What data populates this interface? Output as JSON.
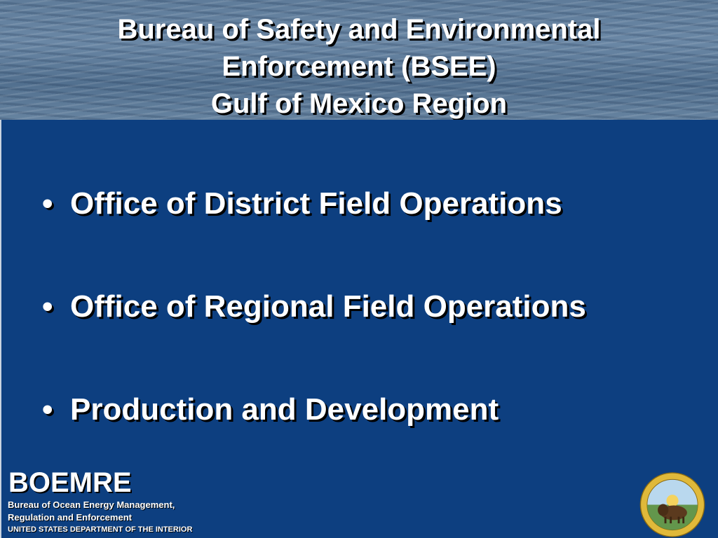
{
  "slide": {
    "title_lines": [
      "Bureau of Safety and Environmental",
      "Enforcement (BSEE)",
      "Gulf of Mexico Region"
    ],
    "bullets": [
      "Office of District Field Operations",
      "Office of Regional Field Operations",
      "Production and Development"
    ],
    "bullet_symbol": "•"
  },
  "footer": {
    "logo": "BOEMRE",
    "org_line1": "Bureau of Ocean Energy Management,",
    "org_line2": "Regulation and Enforcement",
    "dept": "UNITED STATES DEPARTMENT OF THE INTERIOR",
    "seal_icon": "department-of-interior-seal-icon"
  },
  "colors": {
    "content_bg": "#0d3f80",
    "text": "#ffffff",
    "seal_gold": "#e0b93a"
  }
}
